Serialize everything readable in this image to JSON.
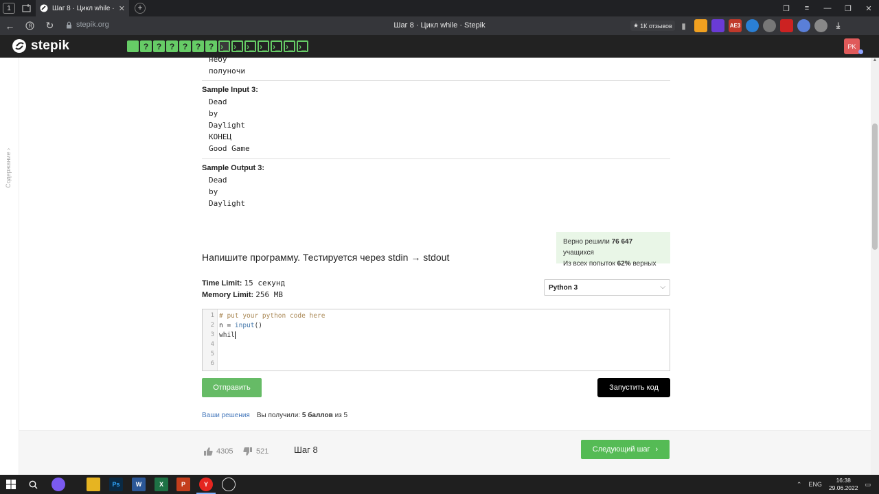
{
  "browser": {
    "tab_counter": "1",
    "tab_title": "Шаг 8 · Цикл while · Stepik",
    "tab_close": "✕",
    "new_tab": "+",
    "url": "stepik.org",
    "page_title": "Шаг 8 · Цикл while · Stepik",
    "reviews": "1К отзывов",
    "extensions": [
      "AE3"
    ]
  },
  "header": {
    "logo": "stepik",
    "steps": [
      "",
      "?",
      "?",
      "?",
      "?",
      "?",
      "?"
    ],
    "code_steps_count": 7,
    "avatar": "PK"
  },
  "sidebar": {
    "toc_label": "Содержание"
  },
  "samples": {
    "prev_output_tail": [
      "небу",
      "полуночи"
    ],
    "input3_label": "Sample Input 3:",
    "input3": [
      "Dead",
      "by",
      "Daylight",
      "КОНЕЦ",
      "Good Game"
    ],
    "output3_label": "Sample Output 3:",
    "output3": [
      "Dead",
      "by",
      "Daylight"
    ]
  },
  "stats": {
    "line1_prefix": "Верно решили",
    "solved_count": "76 647",
    "line1_suffix": "учащихся",
    "line2_prefix": "Из всех попыток",
    "percent": "62%",
    "line2_suffix": "верных"
  },
  "task": {
    "title": "Напишите программу. Тестируется через stdin → stdout",
    "time_label": "Time Limit:",
    "time_value": "15 секунд",
    "memory_label": "Memory Limit:",
    "memory_value": "256 MB",
    "language": "Python 3"
  },
  "editor": {
    "line_numbers": [
      "1",
      "2",
      "3",
      "4",
      "5",
      "6"
    ],
    "comment": "# put your python code here",
    "line2_a": "n = ",
    "line2_fn": "input",
    "line2_b": "()",
    "line3": "whil"
  },
  "actions": {
    "submit": "Отправить",
    "run": "Запустить код",
    "your_solutions": "Ваши решения",
    "received_prefix": "Вы получили:",
    "score": "5 баллов",
    "score_suffix": "из 5"
  },
  "footer": {
    "likes": "4305",
    "dislikes": "521",
    "step": "Шаг 8",
    "next": "Следующий шаг"
  },
  "taskbar": {
    "lang": "ENG",
    "time": "16:38",
    "date": "29.06.2022"
  },
  "colors": {
    "stepik_green": "#66cc66",
    "header_bg": "#222222",
    "stats_bg": "#e9f6e7"
  }
}
